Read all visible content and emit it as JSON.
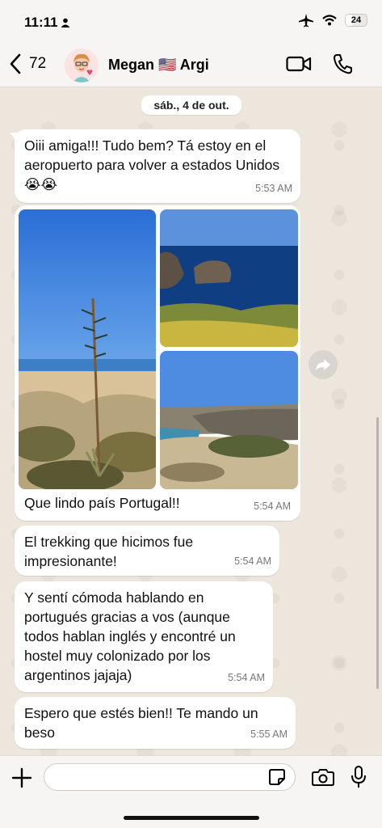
{
  "status_bar": {
    "time": "11:11",
    "battery": "24"
  },
  "header": {
    "back_count": "72",
    "contact_name": "Megan 🇺🇸 Argi"
  },
  "date_separator": "sáb., 4 de out.",
  "messages": [
    {
      "text": "Oiii amiga!!! Tudo bem? Tá estoy en el aeropuerto para volver a estados Unidos 😭😭",
      "time": "5:53 AM"
    },
    {
      "photos": [
        "agave-on-beach-photo",
        "rocks-in-sea-photo",
        "coastal-cliffs-photo"
      ],
      "caption": "Que lindo país Portugal!!",
      "time": "5:54 AM"
    },
    {
      "text": "El trekking que hicimos fue impresionante!",
      "time": "5:54 AM"
    },
    {
      "text": "Y sentí cómoda hablando en portugués gracias a vos (aunque todos hablan inglés y encontré un hostel muy colonizado por los argentinos jajaja)",
      "time": "5:54 AM"
    },
    {
      "text": "Espero que estés bien!! Te mando un beso",
      "time": "5:55 AM"
    }
  ],
  "colors": {
    "wallpaper": "#ece6dd",
    "bubble": "#ffffff",
    "bar": "#f6f5f3",
    "timestamp": "#777777"
  },
  "icons": [
    "person-icon",
    "airplane-icon",
    "wifi-icon",
    "battery-icon",
    "chevron-left-icon",
    "video-camera-icon",
    "phone-icon",
    "forward-icon",
    "plus-icon",
    "sticker-icon",
    "camera-icon",
    "microphone-icon"
  ]
}
